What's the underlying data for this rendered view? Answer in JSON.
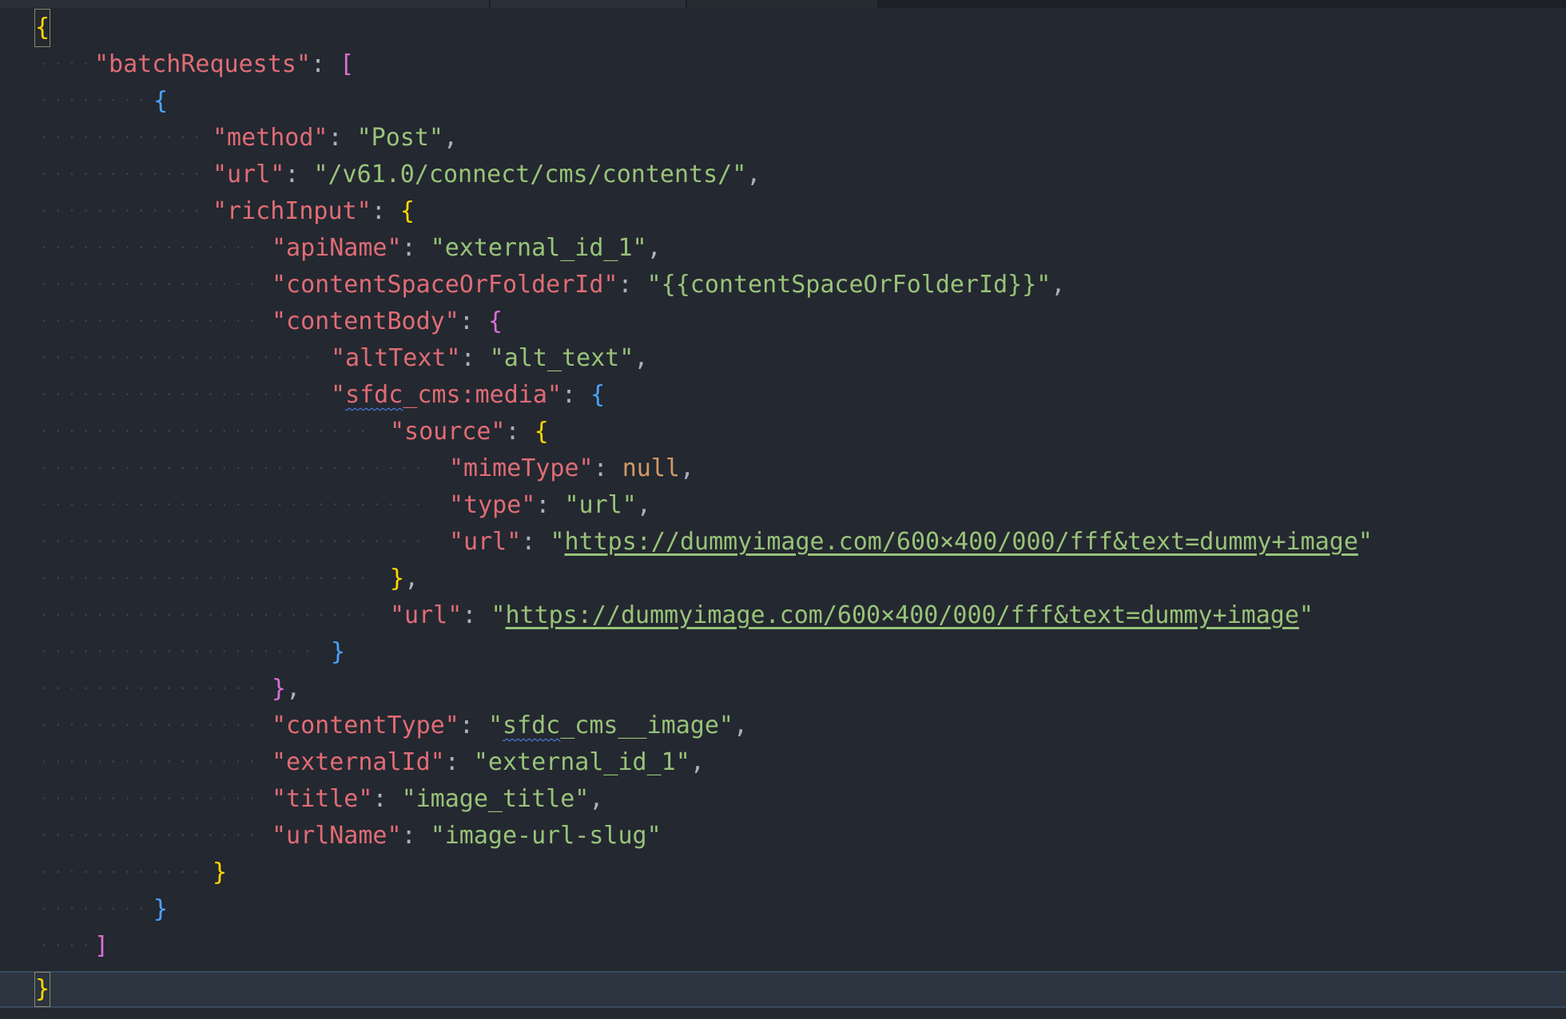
{
  "editor": {
    "language": "json",
    "theme_colors": {
      "background": "#242830",
      "key": "#e06c75",
      "string": "#98c379",
      "keyword": "#d19a66",
      "bracket_level_1": "#ffd700",
      "bracket_level_2": "#da70d6",
      "bracket_level_3": "#4aa3ff"
    },
    "lines": [
      {
        "indent": 0,
        "tokens": [
          {
            "t": "{",
            "c": "b-yellow cursor-brace"
          }
        ]
      },
      {
        "indent": 1,
        "tokens": [
          {
            "t": "\"batchRequests\"",
            "c": "key"
          },
          {
            "t": ": ",
            "c": "punc"
          },
          {
            "t": "[",
            "c": "b-magenta"
          }
        ]
      },
      {
        "indent": 2,
        "tokens": [
          {
            "t": "{",
            "c": "b-blue"
          }
        ]
      },
      {
        "indent": 3,
        "tokens": [
          {
            "t": "\"method\"",
            "c": "key"
          },
          {
            "t": ": ",
            "c": "punc"
          },
          {
            "t": "\"Post\"",
            "c": "str"
          },
          {
            "t": ",",
            "c": "punc"
          }
        ]
      },
      {
        "indent": 3,
        "tokens": [
          {
            "t": "\"url\"",
            "c": "key"
          },
          {
            "t": ": ",
            "c": "punc"
          },
          {
            "t": "\"/v61.0/connect/cms/contents/\"",
            "c": "str"
          },
          {
            "t": ",",
            "c": "punc"
          }
        ]
      },
      {
        "indent": 3,
        "tokens": [
          {
            "t": "\"richInput\"",
            "c": "key"
          },
          {
            "t": ": ",
            "c": "punc"
          },
          {
            "t": "{",
            "c": "b-yellow"
          }
        ]
      },
      {
        "indent": 4,
        "tokens": [
          {
            "t": "\"apiName\"",
            "c": "key"
          },
          {
            "t": ": ",
            "c": "punc"
          },
          {
            "t": "\"external_id_1\"",
            "c": "str"
          },
          {
            "t": ",",
            "c": "punc"
          }
        ]
      },
      {
        "indent": 4,
        "tokens": [
          {
            "t": "\"contentSpaceOrFolderId\"",
            "c": "key"
          },
          {
            "t": ": ",
            "c": "punc"
          },
          {
            "t": "\"{{contentSpaceOrFolderId}}\"",
            "c": "str"
          },
          {
            "t": ",",
            "c": "punc"
          }
        ]
      },
      {
        "indent": 4,
        "tokens": [
          {
            "t": "\"contentBody\"",
            "c": "key"
          },
          {
            "t": ": ",
            "c": "punc"
          },
          {
            "t": "{",
            "c": "b-magenta"
          }
        ]
      },
      {
        "indent": 5,
        "tokens": [
          {
            "t": "\"altText\"",
            "c": "key"
          },
          {
            "t": ": ",
            "c": "punc"
          },
          {
            "t": "\"alt_text\"",
            "c": "str"
          },
          {
            "t": ",",
            "c": "punc"
          }
        ]
      },
      {
        "indent": 5,
        "tokens": [
          {
            "t": "\"",
            "c": "key"
          },
          {
            "t": "sfdc",
            "c": "key squig"
          },
          {
            "t": "_cms:media\"",
            "c": "key"
          },
          {
            "t": ": ",
            "c": "punc"
          },
          {
            "t": "{",
            "c": "b-blue"
          }
        ]
      },
      {
        "indent": 6,
        "tokens": [
          {
            "t": "\"source\"",
            "c": "key"
          },
          {
            "t": ": ",
            "c": "punc"
          },
          {
            "t": "{",
            "c": "b-yellow"
          }
        ]
      },
      {
        "indent": 7,
        "tokens": [
          {
            "t": "\"mimeType\"",
            "c": "key"
          },
          {
            "t": ": ",
            "c": "punc"
          },
          {
            "t": "null",
            "c": "kw"
          },
          {
            "t": ",",
            "c": "punc"
          }
        ]
      },
      {
        "indent": 7,
        "tokens": [
          {
            "t": "\"type\"",
            "c": "key"
          },
          {
            "t": ": ",
            "c": "punc"
          },
          {
            "t": "\"url\"",
            "c": "str"
          },
          {
            "t": ",",
            "c": "punc"
          }
        ]
      },
      {
        "indent": 7,
        "tokens": [
          {
            "t": "\"url\"",
            "c": "key"
          },
          {
            "t": ": ",
            "c": "punc"
          },
          {
            "t": "\"",
            "c": "str"
          },
          {
            "t": "https://dummyimage.com/600×400/000/fff&text=dummy+image",
            "c": "str link"
          },
          {
            "t": "\"",
            "c": "str"
          }
        ]
      },
      {
        "indent": 6,
        "tokens": [
          {
            "t": "}",
            "c": "b-yellow"
          },
          {
            "t": ",",
            "c": "punc"
          }
        ]
      },
      {
        "indent": 6,
        "tokens": [
          {
            "t": "\"url\"",
            "c": "key"
          },
          {
            "t": ": ",
            "c": "punc"
          },
          {
            "t": "\"",
            "c": "str"
          },
          {
            "t": "https://dummyimage.com/600×400/000/fff&text=dummy+image",
            "c": "str link"
          },
          {
            "t": "\"",
            "c": "str"
          }
        ]
      },
      {
        "indent": 5,
        "tokens": [
          {
            "t": "}",
            "c": "b-blue"
          }
        ]
      },
      {
        "indent": 4,
        "tokens": [
          {
            "t": "}",
            "c": "b-magenta"
          },
          {
            "t": ",",
            "c": "punc"
          }
        ]
      },
      {
        "indent": 4,
        "tokens": [
          {
            "t": "\"contentType\"",
            "c": "key"
          },
          {
            "t": ": ",
            "c": "punc"
          },
          {
            "t": "\"",
            "c": "str"
          },
          {
            "t": "sfdc",
            "c": "str squig"
          },
          {
            "t": "_cms__image\"",
            "c": "str"
          },
          {
            "t": ",",
            "c": "punc"
          }
        ]
      },
      {
        "indent": 4,
        "tokens": [
          {
            "t": "\"externalId\"",
            "c": "key"
          },
          {
            "t": ": ",
            "c": "punc"
          },
          {
            "t": "\"external_id_1\"",
            "c": "str"
          },
          {
            "t": ",",
            "c": "punc"
          }
        ]
      },
      {
        "indent": 4,
        "tokens": [
          {
            "t": "\"title\"",
            "c": "key"
          },
          {
            "t": ": ",
            "c": "punc"
          },
          {
            "t": "\"image_title\"",
            "c": "str"
          },
          {
            "t": ",",
            "c": "punc"
          }
        ]
      },
      {
        "indent": 4,
        "tokens": [
          {
            "t": "\"urlName\"",
            "c": "key"
          },
          {
            "t": ": ",
            "c": "punc"
          },
          {
            "t": "\"image-url-slug\"",
            "c": "str"
          }
        ]
      },
      {
        "indent": 3,
        "tokens": [
          {
            "t": "}",
            "c": "b-yellow"
          }
        ]
      },
      {
        "indent": 2,
        "tokens": [
          {
            "t": "}",
            "c": "b-blue"
          }
        ]
      },
      {
        "indent": 1,
        "tokens": [
          {
            "t": "]",
            "c": "b-magenta"
          }
        ]
      },
      {
        "indent": 0,
        "current": true,
        "tokens": [
          {
            "t": "}",
            "c": "b-yellow cursor-brace"
          }
        ]
      }
    ]
  }
}
